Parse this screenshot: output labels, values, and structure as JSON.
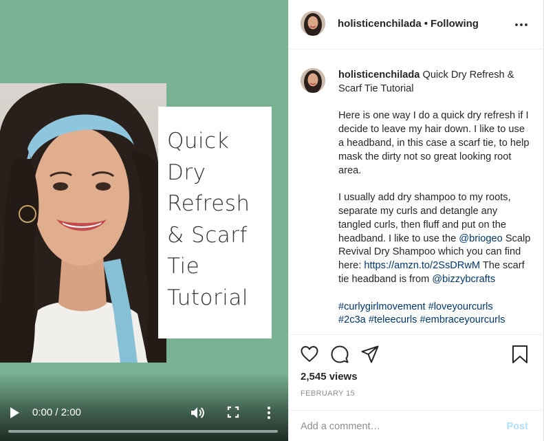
{
  "video": {
    "title_lines": [
      "Quick",
      "Dry",
      "Refresh",
      "& Scarf",
      "Tie",
      "Tutorial"
    ],
    "time": "0:00 / 2:00",
    "colors": {
      "background": "#79b293"
    }
  },
  "header": {
    "username": "holisticenchilada",
    "separator": "•",
    "follow_status": "Following"
  },
  "caption": {
    "username": "holisticenchilada",
    "title_text": "Quick Dry Refresh & Scarf Tie Tutorial",
    "p1": "Here is one way I do a quick dry refresh if I decide to leave my hair down. I like to use a headband, in this case a scarf tie, to help mask the dirty not so great looking root area.",
    "p2_a": "I usually add dry shampoo to my roots, separate my curls and detangle any tangled curls, then fluff and put on the headband. I like to use the ",
    "p2_mention1": "@briogeo",
    "p2_b": " Scalp Revival Dry Shampoo which you can find here: ",
    "p2_link": "https://amzn.to/2SsDRwM",
    "p2_c": " The scarf tie headband is from ",
    "p2_mention2": "@bizzybcrafts",
    "hashtags1": "#curlygirlmovement #loveyourcurls",
    "hashtags2": "#2c3a #teleecurls #embraceyourcurls"
  },
  "stats": {
    "views": "2,545 views",
    "date": "FEBRUARY 15"
  },
  "comment": {
    "placeholder": "Add a comment…",
    "post_label": "Post"
  },
  "icons": [
    "play-icon",
    "volume-icon",
    "fullscreen-icon",
    "more-vertical-icon",
    "more-horizontal-icon",
    "heart-icon",
    "comment-icon",
    "share-icon",
    "bookmark-icon"
  ]
}
